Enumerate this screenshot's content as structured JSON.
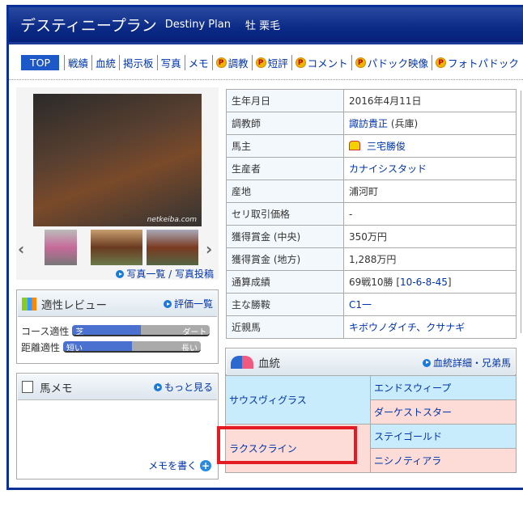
{
  "header": {
    "title": "デスティニープラン",
    "title_en": "Destiny Plan",
    "sex_color": "牡 栗毛"
  },
  "nav": {
    "top": "TOP",
    "items": [
      "戦績",
      "血統",
      "掲示板",
      "写真",
      "メモ"
    ],
    "premium": [
      "調教",
      "短評",
      "コメント",
      "パドック映像",
      "フォトパドック"
    ],
    "premium_badge": "P"
  },
  "photo": {
    "watermark": "netkeiba.com",
    "links": "写真一覧 / 写真投稿",
    "prev": "‹",
    "next": "›"
  },
  "review": {
    "title": "適性レビュー",
    "link": "評価一覧",
    "rows": [
      {
        "label": "コース適性",
        "left": "芝",
        "right": "ダート",
        "value": 0.5
      },
      {
        "label": "距離適性",
        "left": "短い",
        "right": "長い",
        "value": 0.5
      }
    ]
  },
  "memo": {
    "title": "馬メモ",
    "link": "もっと見る",
    "write": "メモを書く"
  },
  "info": [
    {
      "k": "生年月日",
      "v": "2016年4月11日"
    },
    {
      "k": "調教師",
      "v": "諏訪貴正",
      "v2": " (兵庫)"
    },
    {
      "k": "馬主",
      "v": "三宅勝俊"
    },
    {
      "k": "生産者",
      "v": "カナイシスタッド"
    },
    {
      "k": "産地",
      "v": "浦河町"
    },
    {
      "k": "セリ取引価格",
      "v": "-"
    },
    {
      "k": "獲得賞金 (中央)",
      "v": "350万円"
    },
    {
      "k": "獲得賞金 (地方)",
      "v": "1,288万円"
    },
    {
      "k": "通算成績",
      "v": "69戦10勝 [",
      "v2": "10-6-8-45",
      "v3": "]"
    },
    {
      "k": "主な勝鞍",
      "v": "C1一"
    },
    {
      "k": "近親馬",
      "v": "キボウノダイチ、クサナギ"
    }
  ],
  "pedigree": {
    "title": "血統",
    "link": "血統詳細・兄弟馬",
    "sire": "サウスヴィグラス",
    "ss": "エンドスウィープ",
    "sd": "ダーケストスター",
    "dam": "ラクスクライン",
    "ds": "ステイゴールド",
    "dd": "ニシノティアラ"
  }
}
